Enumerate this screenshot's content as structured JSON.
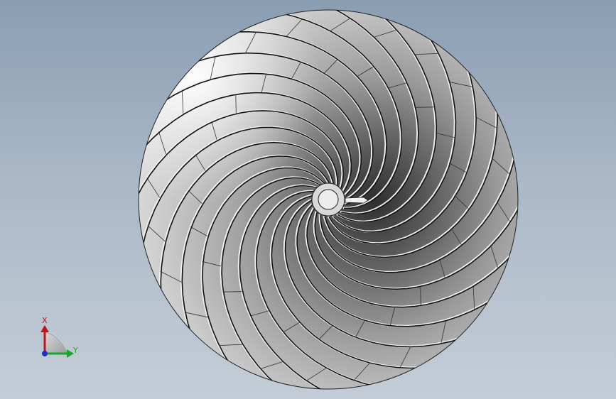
{
  "viewport": {
    "background_top": "#8a9db2",
    "background_bottom": "#c4cdd7"
  },
  "model": {
    "part": "impeller",
    "blade_count": 24,
    "colors": {
      "surface_light": "#f4f4f4",
      "surface_mid": "#b7b7b7",
      "surface_dark": "#3e3e3e",
      "edge": "#111111",
      "hub": "#e6e6e6"
    }
  },
  "triad": {
    "x_label": "X",
    "y_label": "Y",
    "x_color": "#c0131a",
    "y_color": "#1aa52b",
    "z_color": "#1f2fc8",
    "icon": "axis-triad-icon"
  }
}
